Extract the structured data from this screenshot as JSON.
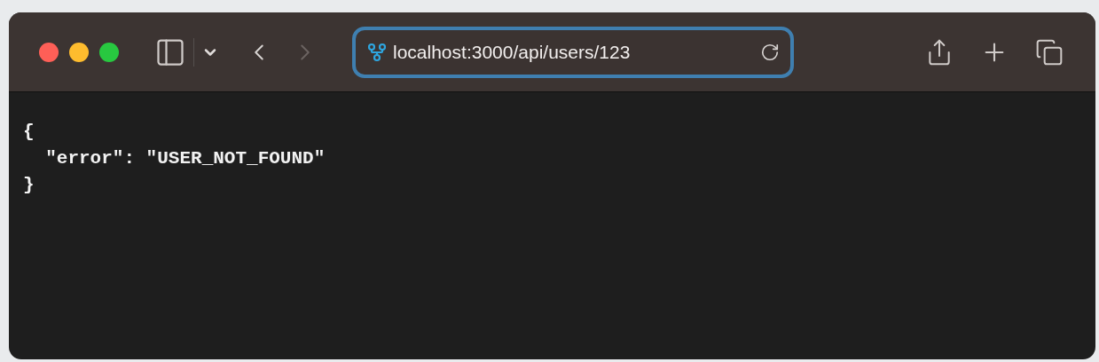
{
  "toolbar": {
    "back": {
      "disabled": false
    },
    "forward": {
      "disabled": true
    }
  },
  "address_bar": {
    "url": "localhost:3000/api/users/123",
    "focused": true
  },
  "content": {
    "lines": [
      "{",
      "  \"error\": \"USER_NOT_FOUND\"",
      "}"
    ]
  }
}
